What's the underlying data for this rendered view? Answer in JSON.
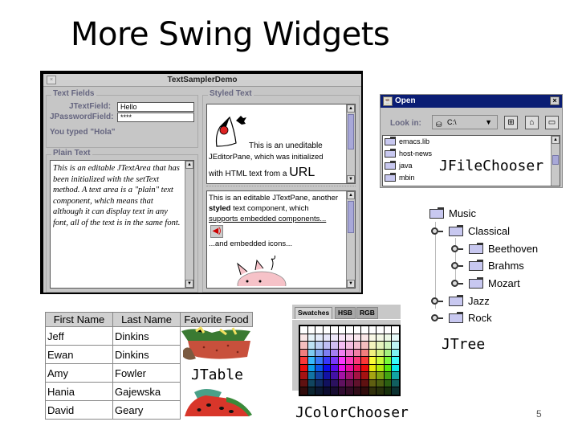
{
  "slide": {
    "title": "More Swing Widgets",
    "page_number": "5"
  },
  "captions": {
    "file_chooser": "JFileChooser",
    "tree": "JTree",
    "table": "JTable",
    "color_chooser": "JColorChooser"
  },
  "text_sampler": {
    "window_title": "TextSamplerDemo",
    "text_fields_group": "Text Fields",
    "jtextfield_label": "JTextField:",
    "jtextfield_value": "Hello",
    "jpasswordfield_label": "JPasswordField:",
    "jpasswordfield_value": "****",
    "you_typed": "You typed \"Hola\"",
    "plain_text_group": "Plain Text",
    "plain_text_content": "This is an editable JTextArea that has been initialized with the setText method. A text area is a \"plain\" text component, which means that although it can display text in any font, all of the text is in the same font.",
    "styled_text_group": "Styled Text",
    "editor_pane_text_1": "This is an uneditable",
    "editor_pane_text_2": "JEditorPane, which was initialized",
    "editor_pane_text_3": "with HTML text from a",
    "editor_pane_url": "URL",
    "text_pane_line_1": "This is an editable JTextPane, another",
    "text_pane_line_2_bold": "styled",
    "text_pane_line_2": " text component, which",
    "text_pane_line_3": "supports embedded components...",
    "text_pane_line_4": "...and embedded icons..."
  },
  "file_chooser": {
    "title": "Open",
    "look_in_label": "Look in:",
    "look_in_value": "C:\\",
    "files": [
      "emacs.lib",
      "host-news",
      "java",
      "mbin"
    ]
  },
  "tree": {
    "root": "Music",
    "nodes": [
      {
        "label": "Classical",
        "level": 1,
        "expanded": true
      },
      {
        "label": "Beethoven",
        "level": 2
      },
      {
        "label": "Brahms",
        "level": 2
      },
      {
        "label": "Mozart",
        "level": 2
      },
      {
        "label": "Jazz",
        "level": 1
      },
      {
        "label": "Rock",
        "level": 1
      }
    ]
  },
  "table": {
    "columns": [
      "First Name",
      "Last Name",
      "Favorite Food"
    ],
    "rows": [
      [
        "Jeff",
        "Dinkins"
      ],
      [
        "Ewan",
        "Dinkins"
      ],
      [
        "Amy",
        "Fowler"
      ],
      [
        "Hania",
        "Gajewska"
      ],
      [
        "David",
        "Geary"
      ]
    ]
  },
  "color_chooser": {
    "tabs": [
      "Swatches",
      "HSB",
      "RGB"
    ],
    "active_tab": "Swatches"
  }
}
